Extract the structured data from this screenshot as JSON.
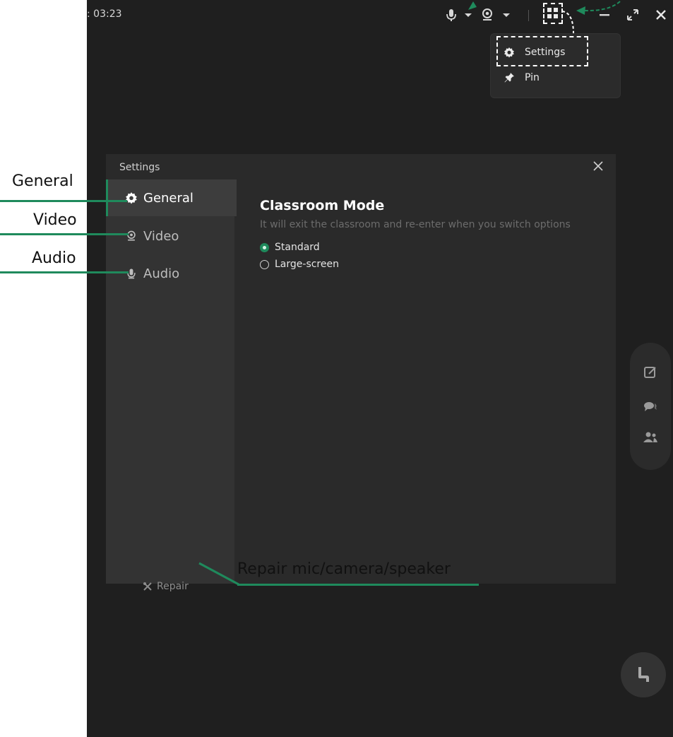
{
  "topbar": {
    "timer": ": 03:23",
    "icons": [
      "mic-icon",
      "caret-down-icon",
      "camera-icon",
      "caret-down-icon",
      "grid-menu-icon",
      "minimize-icon",
      "fullscreen-icon",
      "close-icon"
    ]
  },
  "menu": {
    "items": [
      {
        "label": "Settings",
        "icon": "gear-icon"
      },
      {
        "label": "Pin",
        "icon": "pin-icon"
      }
    ]
  },
  "dialog": {
    "title": "Settings",
    "nav": [
      {
        "label": "General",
        "icon": "gear-icon",
        "active": true
      },
      {
        "label": "Video",
        "icon": "camera-icon",
        "active": false
      },
      {
        "label": "Audio",
        "icon": "mic-icon",
        "active": false
      }
    ],
    "repair_label": "Repair",
    "content": {
      "title": "Classroom Mode",
      "description": "It will exit the classroom and re-enter when you switch options",
      "options": [
        {
          "label": "Standard",
          "selected": true
        },
        {
          "label": "Large-screen",
          "selected": false
        }
      ]
    }
  },
  "side_panel": {
    "icons": [
      "edit-icon",
      "chat-icon",
      "users-icon"
    ]
  },
  "raise_hand": {
    "icon": "raise-hand-icon"
  },
  "callouts": {
    "general": "General",
    "video": "Video",
    "audio": "Audio",
    "repair": "Repair mic/camera/speaker"
  },
  "colors": {
    "accent": "#1f8a5c",
    "background": "#1f1f1f",
    "dialog": "#2a2a2a",
    "sidebar": "#333333"
  }
}
